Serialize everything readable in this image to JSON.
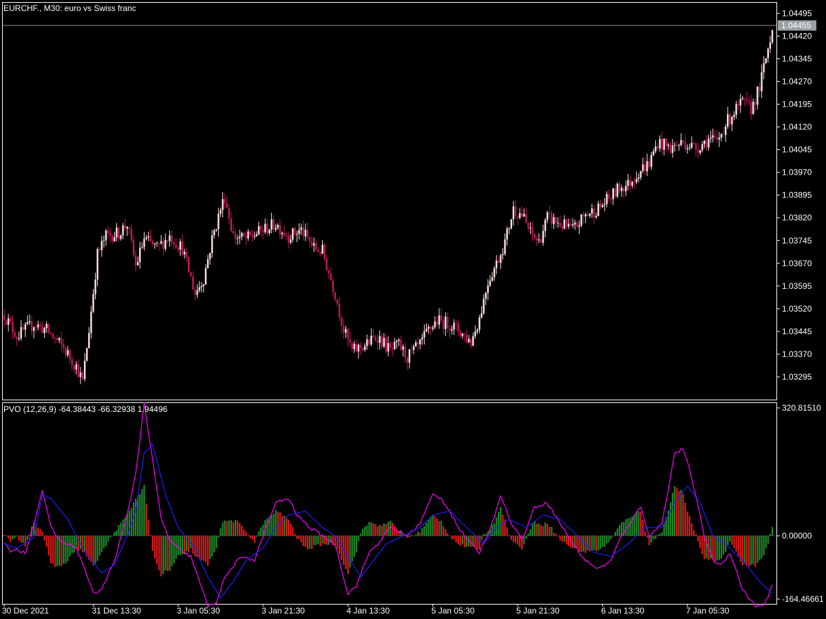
{
  "window": {
    "symbol_label": "EURCHF., M30:  euro vs Swiss franc",
    "indicator_label": "PVO (12,26,9) -64.38443 -66.32938 1.94496"
  },
  "colors": {
    "background": "#000000",
    "frame": "#ffffff",
    "bull_candle": "#ffe4e1",
    "bear_candle": "#c2185b",
    "pvo_line": "#ff00ff",
    "signal_line": "#1e1eff",
    "hist_up": "#1f8a2a",
    "hist_down": "#e01b1b",
    "bid_line": "#8a8f96"
  },
  "chart_data": [
    {
      "type": "candlestick",
      "name": "EURCHF., M30",
      "title": "euro vs Swiss franc",
      "ylim": [
        1.0322,
        1.0453
      ],
      "y_ticks": [
        "1.04495",
        "1.04420",
        "1.04345",
        "1.04270",
        "1.04195",
        "1.04120",
        "1.04045",
        "1.03970",
        "1.03895",
        "1.03820",
        "1.03745",
        "1.03670",
        "1.03595",
        "1.03520",
        "1.03445",
        "1.03370",
        "1.03295"
      ],
      "current_price": "1.04455",
      "close_anchors": [
        [
          0,
          1.035
        ],
        [
          6,
          1.0343
        ],
        [
          14,
          1.0347
        ],
        [
          20,
          1.0345
        ],
        [
          28,
          1.0339
        ],
        [
          34,
          1.0333
        ],
        [
          37,
          1.0328
        ],
        [
          40,
          1.0345
        ],
        [
          44,
          1.037
        ],
        [
          48,
          1.0376
        ],
        [
          54,
          1.0377
        ],
        [
          58,
          1.038
        ],
        [
          62,
          1.0366
        ],
        [
          66,
          1.0375
        ],
        [
          72,
          1.0372
        ],
        [
          78,
          1.0376
        ],
        [
          84,
          1.0372
        ],
        [
          90,
          1.0357
        ],
        [
          94,
          1.0362
        ],
        [
          98,
          1.0375
        ],
        [
          102,
          1.0385
        ],
        [
          104,
          1.0389
        ],
        [
          108,
          1.0376
        ],
        [
          114,
          1.0375
        ],
        [
          122,
          1.0378
        ],
        [
          128,
          1.038
        ],
        [
          134,
          1.0376
        ],
        [
          140,
          1.0378
        ],
        [
          146,
          1.0372
        ],
        [
          150,
          1.0371
        ],
        [
          156,
          1.0357
        ],
        [
          160,
          1.0345
        ],
        [
          164,
          1.0338
        ],
        [
          170,
          1.034
        ],
        [
          176,
          1.0343
        ],
        [
          182,
          1.0338
        ],
        [
          186,
          1.034
        ],
        [
          190,
          1.0336
        ],
        [
          196,
          1.034
        ],
        [
          200,
          1.0345
        ],
        [
          204,
          1.0348
        ],
        [
          210,
          1.0347
        ],
        [
          214,
          1.0345
        ],
        [
          220,
          1.0341
        ],
        [
          224,
          1.0349
        ],
        [
          228,
          1.0361
        ],
        [
          232,
          1.0367
        ],
        [
          236,
          1.0374
        ],
        [
          240,
          1.0385
        ],
        [
          244,
          1.0383
        ],
        [
          248,
          1.0377
        ],
        [
          252,
          1.0374
        ],
        [
          256,
          1.0382
        ],
        [
          262,
          1.038
        ],
        [
          268,
          1.0378
        ],
        [
          274,
          1.0383
        ],
        [
          280,
          1.0385
        ],
        [
          286,
          1.0389
        ],
        [
          290,
          1.0392
        ],
        [
          294,
          1.0393
        ],
        [
          300,
          1.0398
        ],
        [
          304,
          1.04
        ],
        [
          308,
          1.0407
        ],
        [
          314,
          1.0405
        ],
        [
          320,
          1.0407
        ],
        [
          326,
          1.0405
        ],
        [
          332,
          1.0408
        ],
        [
          336,
          1.0407
        ],
        [
          340,
          1.0413
        ],
        [
          344,
          1.0417
        ],
        [
          348,
          1.042
        ],
        [
          352,
          1.0418
        ],
        [
          356,
          1.0425
        ],
        [
          360,
          1.0438
        ],
        [
          362,
          1.0445
        ]
      ],
      "bar_count": 363
    },
    {
      "type": "mixed",
      "name": "PVO (12,26,9)",
      "values": {
        "pvo": -64.38443,
        "signal": -66.32938,
        "histogram": 1.94496
      },
      "ylim": [
        -164.46661,
        320.8151
      ],
      "y_ticks": [
        "320.81510",
        "0.00000",
        "-164.46661"
      ],
      "series": [
        {
          "name": "PVO",
          "points": [
            [
              0,
              -15
            ],
            [
              3,
              -40
            ],
            [
              6,
              -35
            ],
            [
              10,
              -40
            ],
            [
              14,
              30
            ],
            [
              18,
              110
            ],
            [
              22,
              20
            ],
            [
              26,
              -10
            ],
            [
              30,
              -20
            ],
            [
              34,
              -30
            ],
            [
              38,
              -80
            ],
            [
              42,
              -140
            ],
            [
              46,
              -130
            ],
            [
              52,
              -60
            ],
            [
              58,
              50
            ],
            [
              62,
              150
            ],
            [
              66,
              320
            ],
            [
              70,
              180
            ],
            [
              74,
              40
            ],
            [
              78,
              -10
            ],
            [
              84,
              -40
            ],
            [
              88,
              -50
            ],
            [
              92,
              -110
            ],
            [
              96,
              -170
            ],
            [
              100,
              -160
            ],
            [
              104,
              -100
            ],
            [
              110,
              -60
            ],
            [
              114,
              -50
            ],
            [
              118,
              -60
            ],
            [
              122,
              0
            ],
            [
              128,
              80
            ],
            [
              134,
              90
            ],
            [
              138,
              50
            ],
            [
              144,
              20
            ],
            [
              150,
              0
            ],
            [
              156,
              -20
            ],
            [
              162,
              -140
            ],
            [
              166,
              -120
            ],
            [
              172,
              -40
            ],
            [
              176,
              -20
            ],
            [
              182,
              20
            ],
            [
              186,
              10
            ],
            [
              190,
              0
            ],
            [
              196,
              30
            ],
            [
              202,
              100
            ],
            [
              206,
              90
            ],
            [
              210,
              60
            ],
            [
              214,
              20
            ],
            [
              220,
              -20
            ],
            [
              224,
              -40
            ],
            [
              230,
              30
            ],
            [
              234,
              100
            ],
            [
              238,
              40
            ],
            [
              244,
              -10
            ],
            [
              250,
              70
            ],
            [
              256,
              80
            ],
            [
              262,
              30
            ],
            [
              268,
              -20
            ],
            [
              274,
              -60
            ],
            [
              280,
              -80
            ],
            [
              286,
              -60
            ],
            [
              290,
              -10
            ],
            [
              296,
              40
            ],
            [
              300,
              70
            ],
            [
              304,
              0
            ],
            [
              310,
              30
            ],
            [
              316,
              200
            ],
            [
              320,
              210
            ],
            [
              324,
              140
            ],
            [
              330,
              0
            ],
            [
              334,
              -60
            ],
            [
              338,
              -70
            ],
            [
              342,
              -40
            ],
            [
              348,
              -130
            ],
            [
              354,
              -170
            ],
            [
              358,
              -170
            ],
            [
              362,
              -120
            ]
          ]
        },
        {
          "name": "Signal",
          "points": [
            [
              0,
              -20
            ],
            [
              6,
              -30
            ],
            [
              14,
              -5
            ],
            [
              18,
              100
            ],
            [
              22,
              90
            ],
            [
              30,
              40
            ],
            [
              38,
              -40
            ],
            [
              46,
              -90
            ],
            [
              52,
              -70
            ],
            [
              58,
              0
            ],
            [
              62,
              60
            ],
            [
              66,
              200
            ],
            [
              70,
              220
            ],
            [
              76,
              100
            ],
            [
              82,
              20
            ],
            [
              90,
              -30
            ],
            [
              96,
              -100
            ],
            [
              102,
              -150
            ],
            [
              108,
              -110
            ],
            [
              114,
              -60
            ],
            [
              122,
              -30
            ],
            [
              128,
              20
            ],
            [
              134,
              50
            ],
            [
              142,
              60
            ],
            [
              150,
              20
            ],
            [
              156,
              0
            ],
            [
              162,
              -50
            ],
            [
              168,
              -100
            ],
            [
              174,
              -60
            ],
            [
              180,
              -20
            ],
            [
              188,
              0
            ],
            [
              196,
              20
            ],
            [
              202,
              50
            ],
            [
              210,
              60
            ],
            [
              218,
              20
            ],
            [
              226,
              -20
            ],
            [
              232,
              20
            ],
            [
              238,
              40
            ],
            [
              246,
              20
            ],
            [
              254,
              50
            ],
            [
              262,
              40
            ],
            [
              270,
              0
            ],
            [
              278,
              -40
            ],
            [
              286,
              -50
            ],
            [
              294,
              -20
            ],
            [
              302,
              20
            ],
            [
              310,
              20
            ],
            [
              316,
              80
            ],
            [
              322,
              120
            ],
            [
              328,
              80
            ],
            [
              334,
              0
            ],
            [
              340,
              -20
            ],
            [
              348,
              -60
            ],
            [
              356,
              -110
            ],
            [
              362,
              -140
            ]
          ]
        },
        {
          "name": "Histogram",
          "type": "bar",
          "derived_from": [
            "PVO",
            "Signal"
          ]
        }
      ]
    }
  ],
  "time_axis": {
    "labels": [
      "30 Dec 2021",
      "31 Dec 13:30",
      "3 Jan 05:30",
      "3 Jan 21:30",
      "4 Jan 13:30",
      "5 Jan 05:30",
      "5 Jan 21:30",
      "6 Jan 13:30",
      "7 Jan 05:30"
    ],
    "label_bars": [
      0,
      42,
      82,
      122,
      162,
      202,
      242,
      282,
      322
    ]
  }
}
